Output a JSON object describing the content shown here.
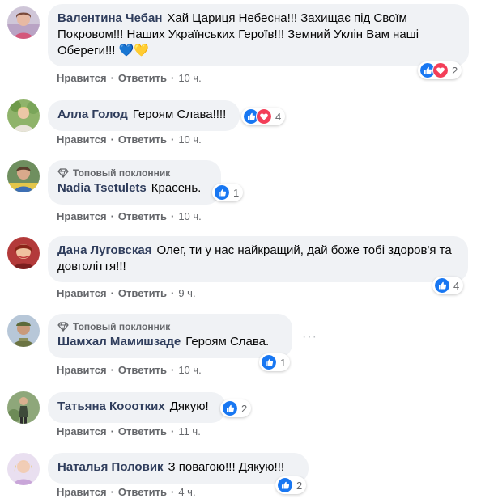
{
  "labels": {
    "like": "Нравится",
    "reply": "Ответить",
    "sep": "·"
  },
  "comments": [
    {
      "author": "Валентина Чебан",
      "text": "Хай Цариця Небесна!!! Захищає під Своїм Покровом!!! Наших Українських Героїв!!! Земний Уклін Вам наші Обереги!!!",
      "emoji": "💙💛",
      "time": "10 ч.",
      "reaction_count": "2",
      "reactions": [
        "like-icon",
        "love-icon"
      ]
    },
    {
      "author": "Алла Голод",
      "text": "Героям Слава!!!!",
      "time": "10 ч.",
      "reaction_count": "4",
      "reactions": [
        "like-icon",
        "love-icon"
      ]
    },
    {
      "badge": "Топовый поклонник",
      "author": "Nadia Tsetulets",
      "text": "Красень.",
      "time": "10 ч.",
      "reaction_count": "1",
      "reactions": [
        "like-icon"
      ]
    },
    {
      "author": "Дана Луговская",
      "text": "Олег, ти у нас найкращий, дай боже тобі здоров'я та довголіття!!!",
      "time": "9 ч.",
      "reaction_count": "4",
      "reactions": [
        "like-icon"
      ]
    },
    {
      "badge": "Топовый поклонник",
      "author": "Шамхал Мамишзаде",
      "text": "Героям Слава.",
      "time": "10 ч.",
      "reaction_count": "1",
      "reactions": [
        "like-icon"
      ]
    },
    {
      "author": "Татьяна Кооотких",
      "text": "Дякую!",
      "time": "11 ч.",
      "reaction_count": "2",
      "reactions": [
        "like-icon"
      ]
    },
    {
      "author": "Наталья Половик",
      "text": "З повагою!!! Дякую!!!",
      "time": "4 ч.",
      "reaction_count": "2",
      "reactions": [
        "like-icon"
      ]
    }
  ],
  "colors": {
    "author": "#2f3d5c",
    "bubble": "#f0f2f5",
    "meta": "#65676b",
    "like_blue": "#1877f2",
    "love_red": "#f33e58"
  }
}
